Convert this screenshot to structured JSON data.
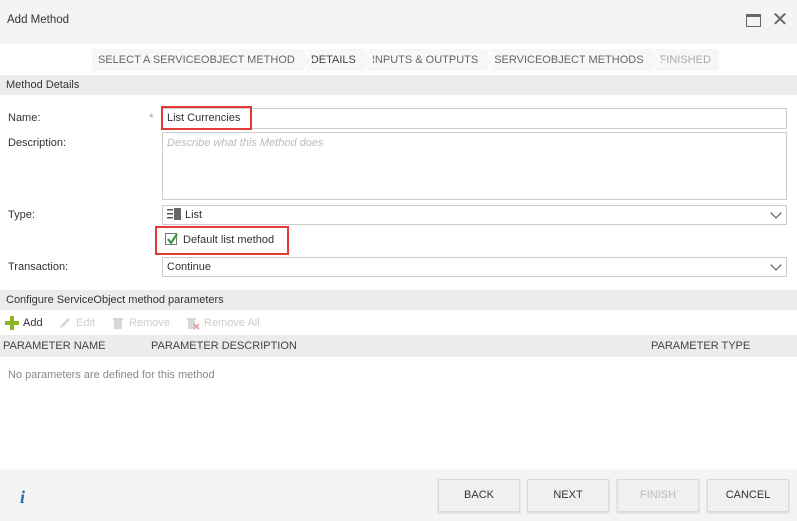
{
  "window": {
    "title": "Add Method"
  },
  "wizard": {
    "steps": [
      {
        "label": "SELECT A SERVICEOBJECT METHOD"
      },
      {
        "label": "DETAILS"
      },
      {
        "label": "INPUTS & OUTPUTS"
      },
      {
        "label": "SERVICEOBJECT METHODS"
      },
      {
        "label": "FINISHED"
      }
    ]
  },
  "details": {
    "section_title": "Method Details",
    "name_label": "Name:",
    "name_value": "List Currencies",
    "required_marker": "*",
    "description_label": "Description:",
    "description_placeholder": "Describe what this Method does",
    "type_label": "Type:",
    "type_value": "List",
    "default_list_label": "Default list method",
    "default_list_checked": true,
    "transaction_label": "Transaction:",
    "transaction_value": "Continue"
  },
  "parameters": {
    "section_title": "Configure ServiceObject method parameters",
    "toolbar": {
      "add": "Add",
      "edit": "Edit",
      "remove": "Remove",
      "remove_all": "Remove All"
    },
    "columns": [
      "PARAMETER NAME",
      "PARAMETER DESCRIPTION",
      "PARAMETER TYPE"
    ],
    "empty_message": "No parameters are defined for this method"
  },
  "footer": {
    "info": "i",
    "back": "BACK",
    "next": "NEXT",
    "finish": "FINISH",
    "cancel": "CANCEL"
  },
  "colors": {
    "highlight": "#e53935",
    "add_icon": "#8bb626",
    "info_icon": "#2a6db5",
    "check": "#3a9a3a"
  }
}
